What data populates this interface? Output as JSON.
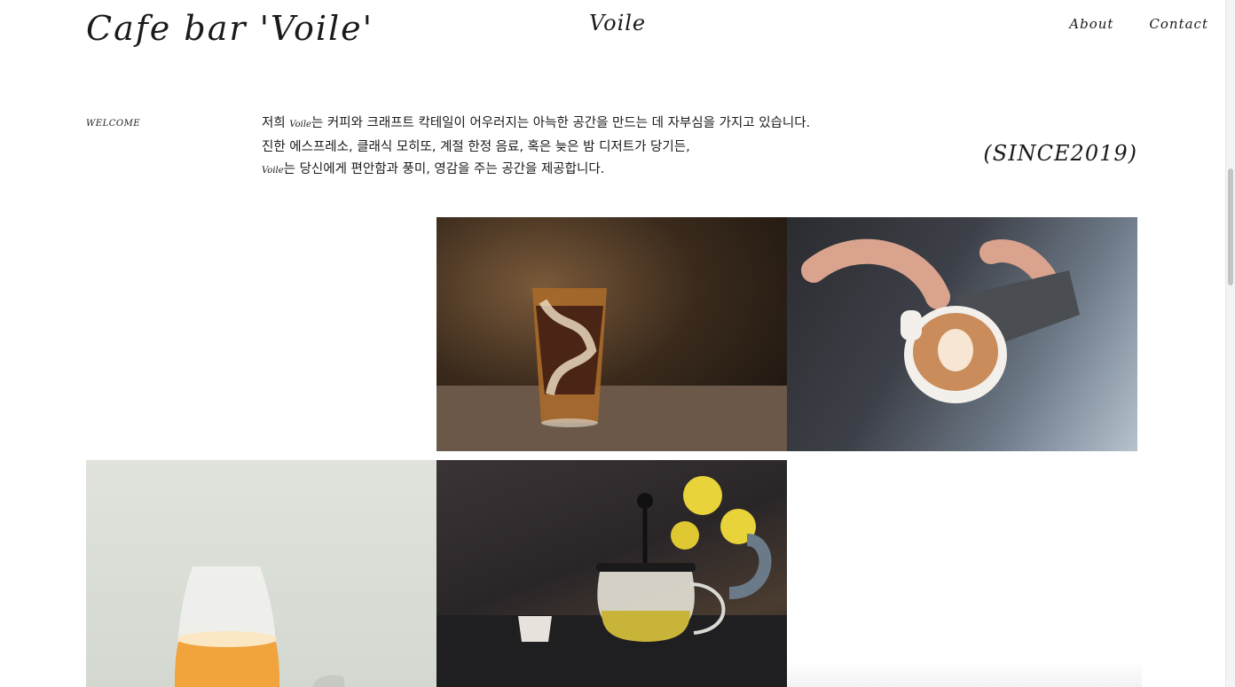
{
  "header": {
    "site_title": "Cafe bar 'Voile'",
    "center_logo": "Voile",
    "nav": {
      "about": "About",
      "contact": "Contact"
    }
  },
  "welcome": {
    "label": "WELCOME",
    "line1_prefix": "저희 ",
    "line1_brand": "Voile",
    "line1_rest": "는 커피와 크래프트 칵테일이 어우러지는 아늑한 공간을 만드는 데 자부심을 가지고 있습니다.",
    "line2": "진한 에스프레소, 클래식 모히또, 계절 한정 음료, 혹은 늦은 밤 디저트가 당기든,",
    "line3_brand": "Voile",
    "line3_rest": "는 당신에게 편안함과 풍미, 영감을 주는 공간을 제공합니다.",
    "since": "(SINCE2019)"
  },
  "gallery": [
    {
      "name": "iced-latte-photo"
    },
    {
      "name": "latte-art-photo"
    },
    {
      "name": "beer-glass-photo"
    },
    {
      "name": "tea-pot-photo"
    }
  ],
  "colors": {
    "background": "#ffffff",
    "text": "#1a1a1a"
  }
}
